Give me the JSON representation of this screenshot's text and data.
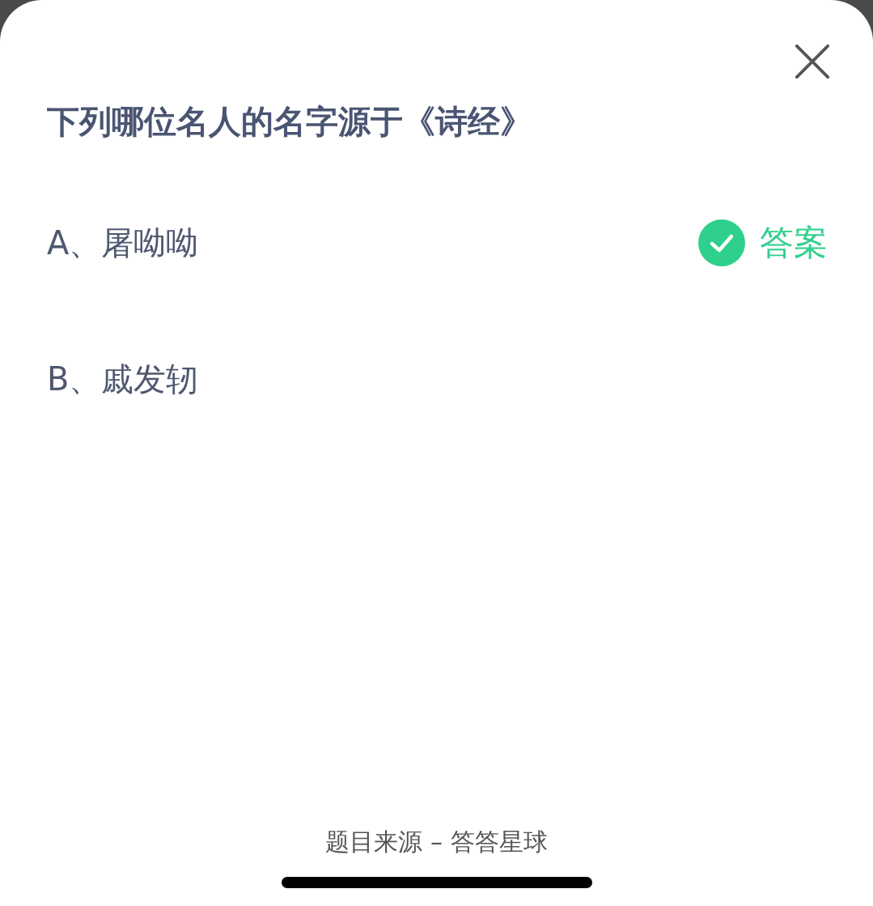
{
  "question": {
    "title": "下列哪位名人的名字源于《诗经》"
  },
  "options": [
    {
      "text": "A、屠呦呦",
      "correct": true
    },
    {
      "text": "B、戚发轫",
      "correct": false
    }
  ],
  "answer_badge": {
    "label": "答案"
  },
  "footer": {
    "source": "题目来源 – 答答星球"
  }
}
